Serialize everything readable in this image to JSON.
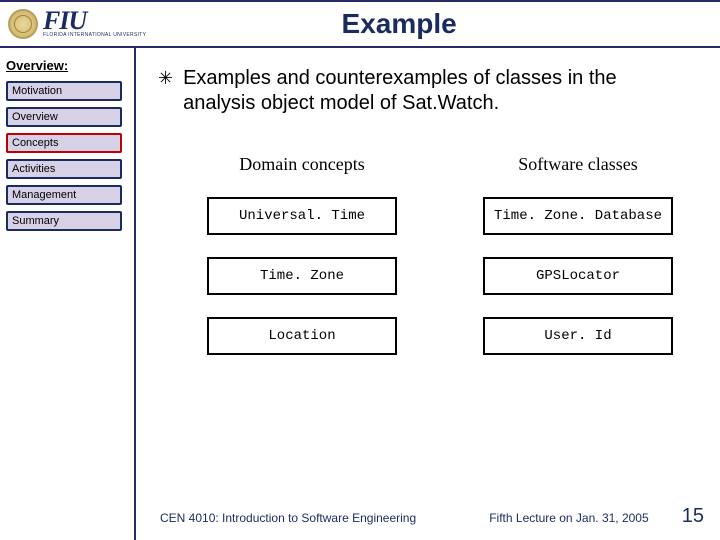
{
  "header": {
    "logo_main": "FIU",
    "logo_sub": "FLORIDA INTERNATIONAL UNIVERSITY",
    "title": "Example"
  },
  "sidebar": {
    "heading": "Overview:",
    "items": [
      {
        "label": "Motivation",
        "active": false
      },
      {
        "label": "Overview",
        "active": false
      },
      {
        "label": "Concepts",
        "active": true
      },
      {
        "label": "Activities",
        "active": false
      },
      {
        "label": "Management",
        "active": false
      },
      {
        "label": "Summary",
        "active": false
      }
    ]
  },
  "content": {
    "bullet": "Examples and counterexamples of classes in the analysis object model of Sat.Watch.",
    "columns": [
      {
        "heading": "Domain concepts",
        "items": [
          "Universal. Time",
          "Time. Zone",
          "Location"
        ]
      },
      {
        "heading": "Software classes",
        "items": [
          "Time. Zone. Database",
          "GPSLocator",
          "User. Id"
        ]
      }
    ]
  },
  "footer": {
    "left": "CEN 4010: Introduction to Software Engineering",
    "center": "Fifth Lecture on Jan. 31, 2005",
    "page": "15"
  }
}
